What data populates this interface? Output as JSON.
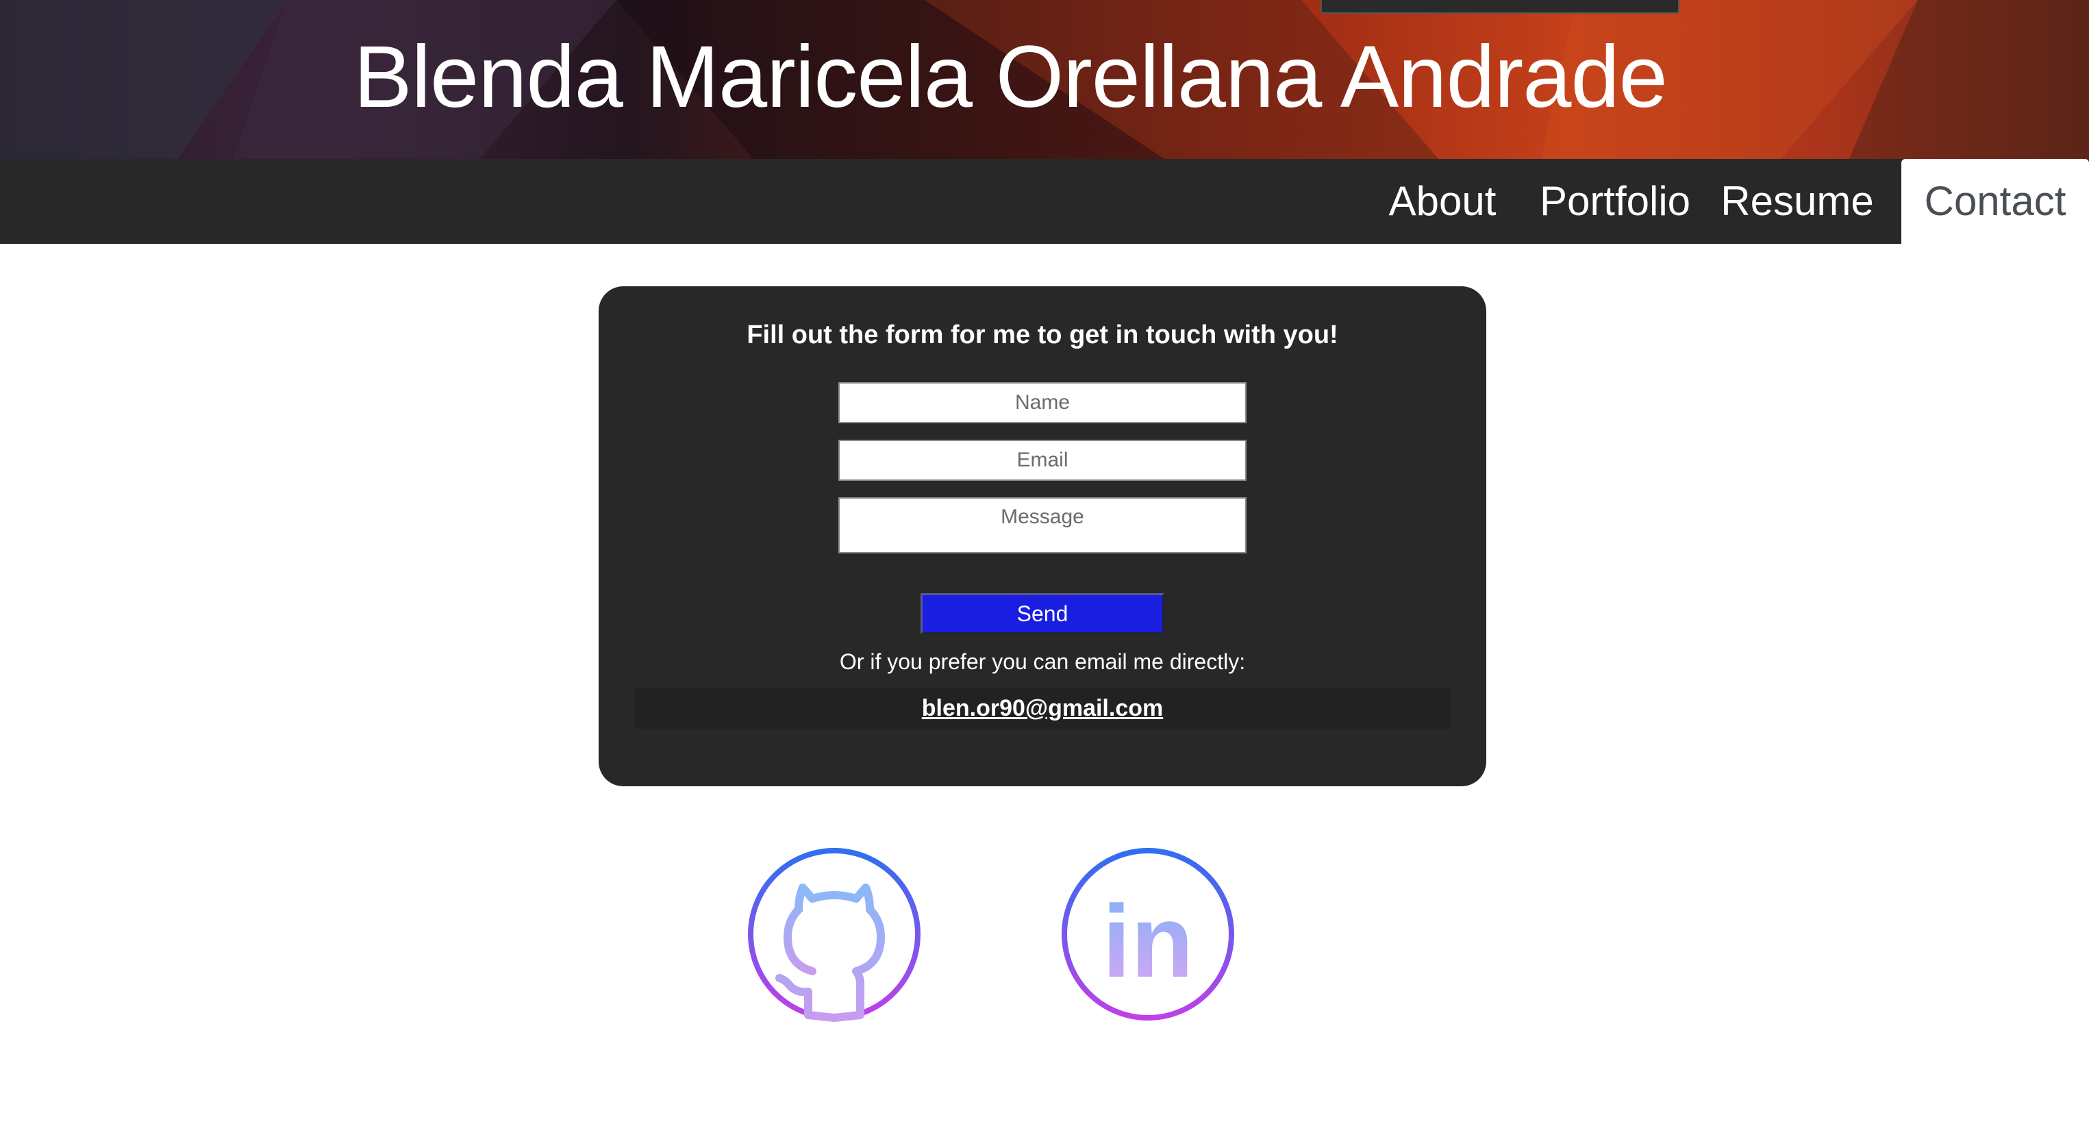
{
  "header": {
    "title": "Blenda Maricela Orellana Andrade"
  },
  "nav": {
    "items": [
      {
        "label": "About"
      },
      {
        "label": "Portfolio"
      },
      {
        "label": "Resume"
      },
      {
        "label": "Contact",
        "active": true
      }
    ]
  },
  "contact": {
    "heading": "Fill out the form for me to get in touch with you!",
    "name_placeholder": "Name",
    "email_placeholder": "Email",
    "message_placeholder": "Message",
    "send_label": "Send",
    "alt_text": "Or if you prefer you can email me directly:",
    "email": "blen.or90@gmail.com"
  },
  "social": {
    "icons": [
      "github-icon",
      "linkedin-icon"
    ],
    "linkedin_glyph": "in"
  },
  "colors": {
    "nav_bg": "#282828",
    "card_bg": "#282828",
    "send_button": "#1a1ee0",
    "icon_gradient_start": "#2f6ff0",
    "icon_gradient_end": "#c040e8"
  }
}
